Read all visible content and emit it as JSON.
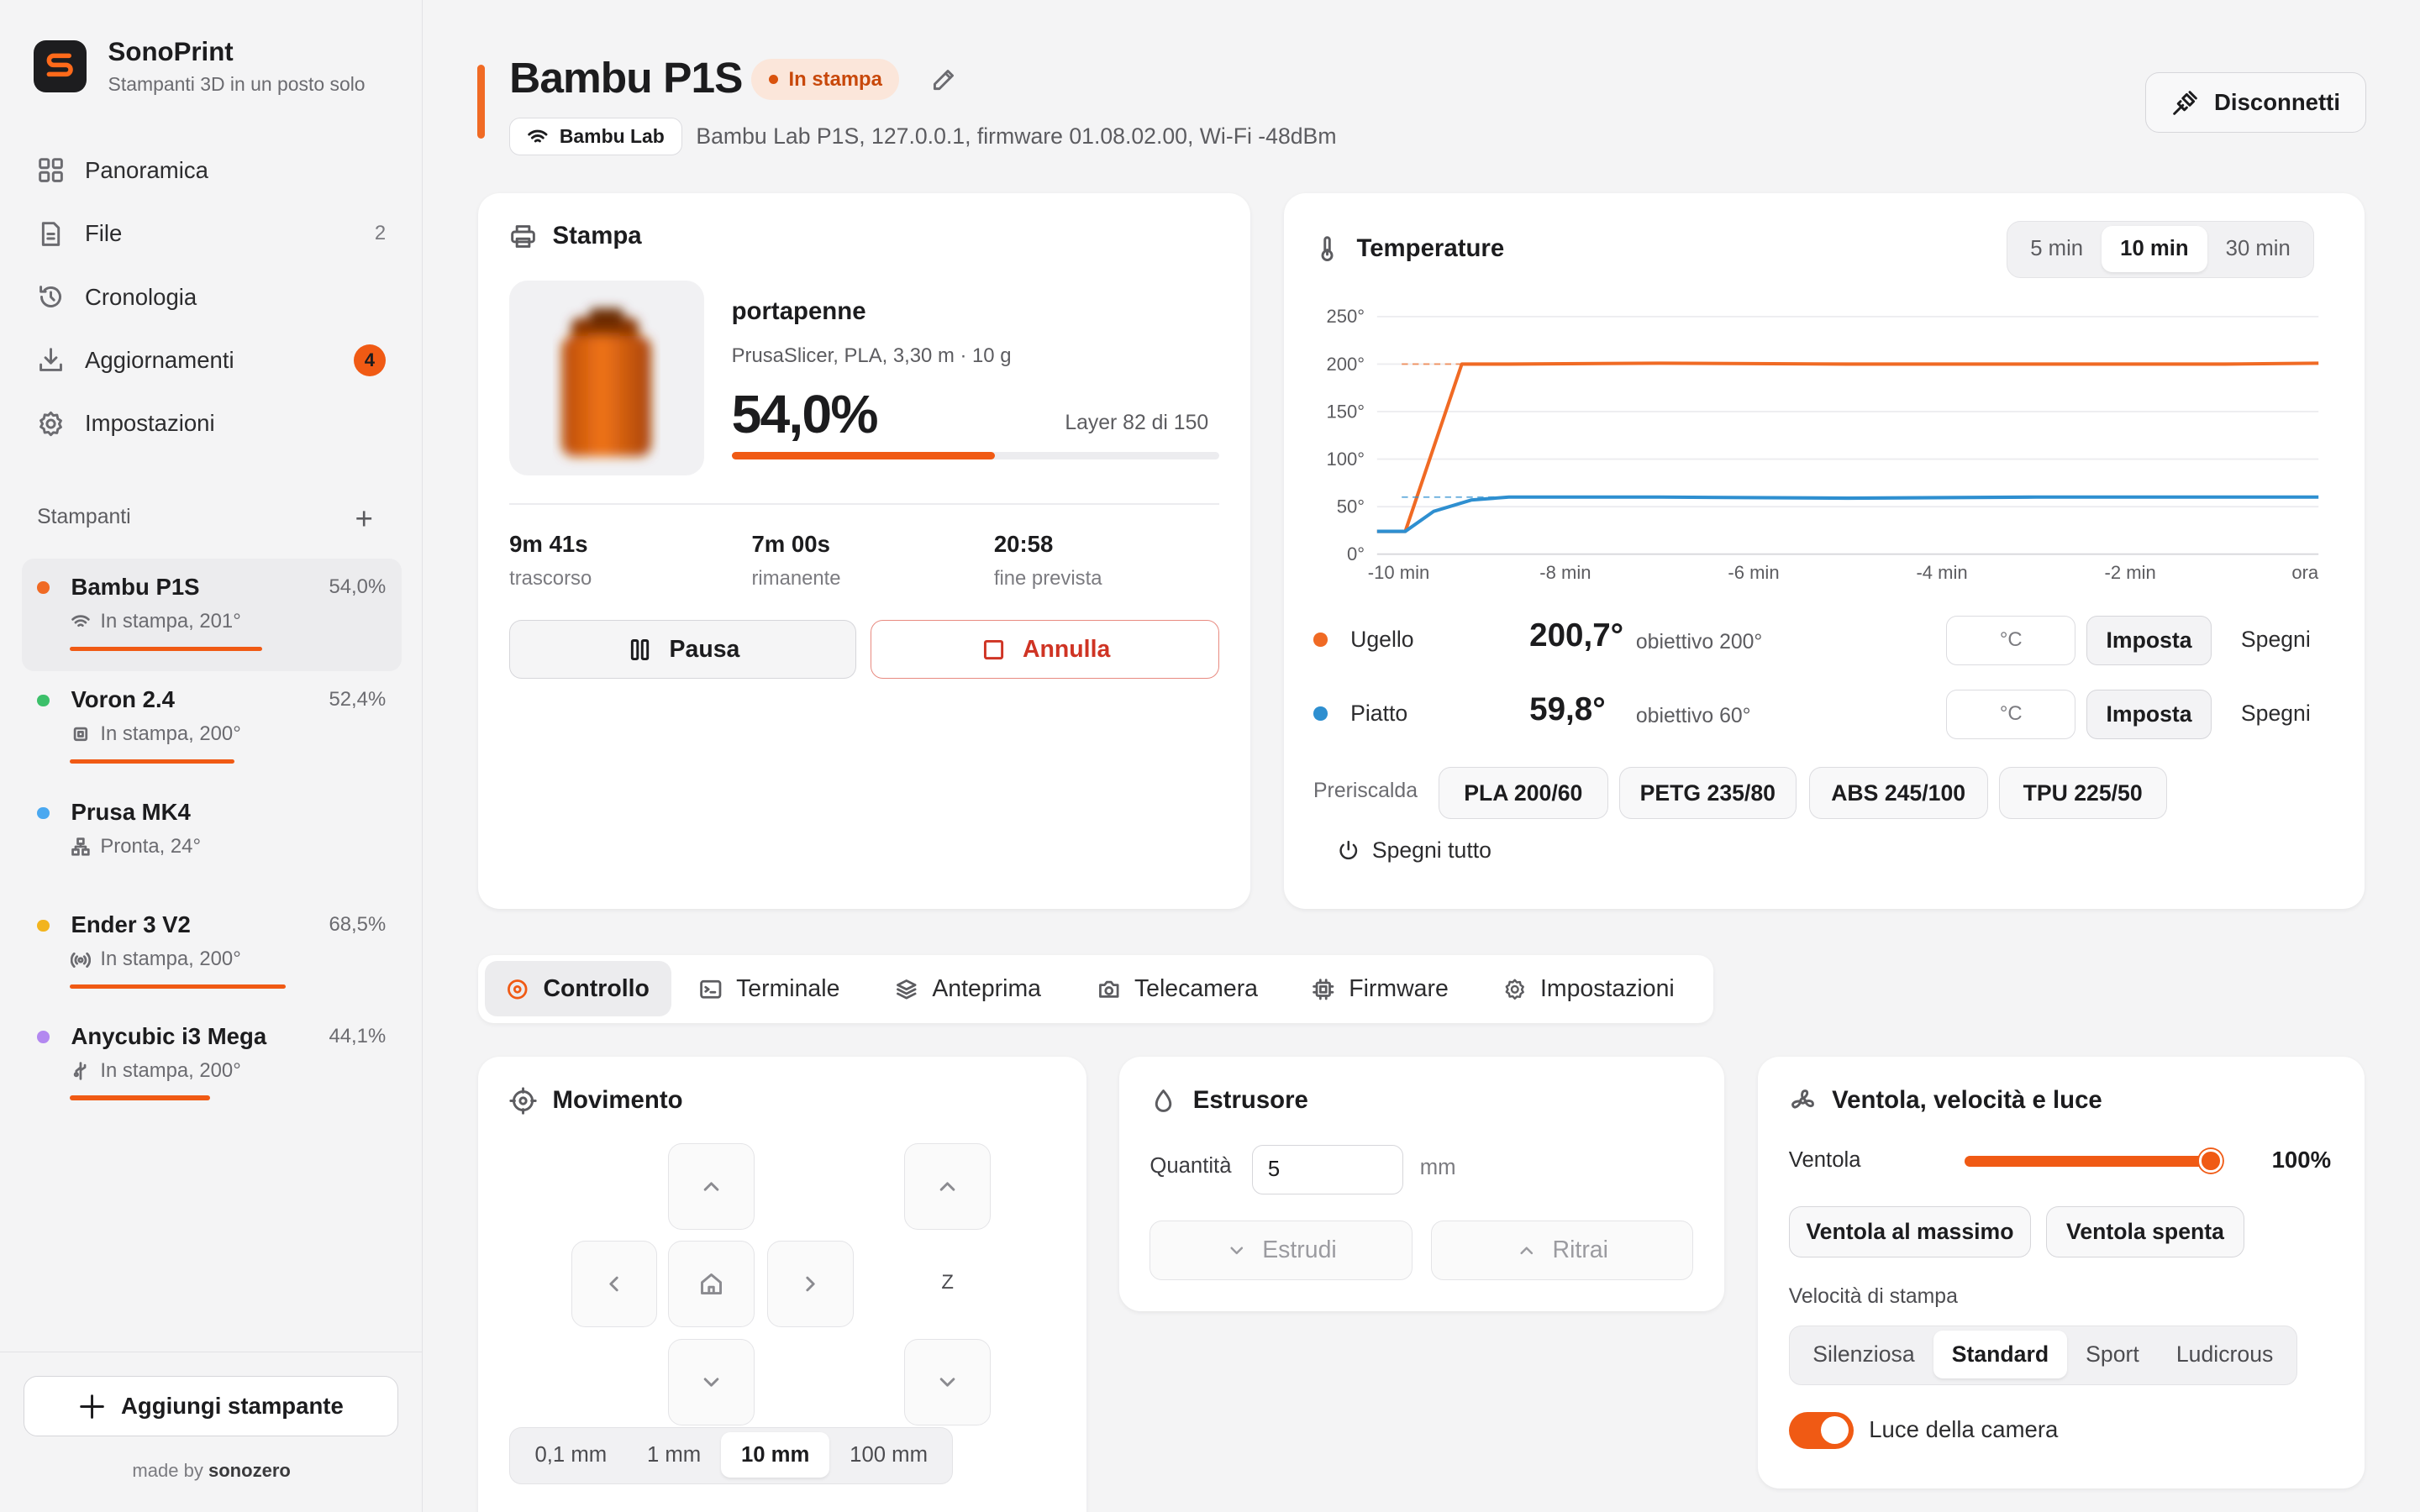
{
  "brand": {
    "name": "SonoPrint",
    "tagline": "Stampanti 3D in un posto solo",
    "logo": "S"
  },
  "nav": [
    {
      "label": "Panoramica",
      "icon": "grid-icon"
    },
    {
      "label": "File",
      "icon": "file-icon",
      "count": "2"
    },
    {
      "label": "Cronologia",
      "icon": "history-icon"
    },
    {
      "label": "Aggiornamenti",
      "icon": "download-icon",
      "badge": "4"
    },
    {
      "label": "Impostazioni",
      "icon": "gear-icon"
    }
  ],
  "printers_section": {
    "label": "Stampanti",
    "add": "+"
  },
  "printers": [
    {
      "name": "Bambu P1S",
      "percent": "54,0%",
      "status": "In stampa, 201°",
      "dot": "#f06a24",
      "progress": 0.54
    },
    {
      "name": "Voron 2.4",
      "percent": "52,4%",
      "status": "In stampa, 200°",
      "dot": "#3cc06a",
      "progress": 0.524
    },
    {
      "name": "Prusa MK4",
      "percent": "",
      "status": "Pronta, 24°",
      "dot": "#4aa8f0",
      "progress": 0
    },
    {
      "name": "Ender 3 V2",
      "percent": "68,5%",
      "status": "In stampa, 200°",
      "dot": "#f2b41e",
      "progress": 0.685
    },
    {
      "name": "Anycubic i3 Mega",
      "percent": "44,1%",
      "status": "In stampa, 200°",
      "dot": "#b388f0",
      "progress": 0.441
    }
  ],
  "sidebar_footer": {
    "add_printer": "Aggiungi stampante",
    "made_prefix": "made by",
    "made_by": "sonozero"
  },
  "header": {
    "title": "Bambu P1S",
    "status": "In stampa",
    "vendor": "Bambu Lab",
    "info": "Bambu Lab P1S, 127.0.0.1, firmware 01.08.02.00, Wi-Fi -48dBm",
    "disconnect": "Disconnetti"
  },
  "print_card": {
    "title": "Stampa",
    "file": "portapenne",
    "meta": "PrusaSlicer, PLA, 3,30 m · 10 g",
    "percent": "54,0%",
    "progress": 0.54,
    "layer": "Layer 82 di 150",
    "stats": [
      {
        "value": "9m 41s",
        "label": "trascorso"
      },
      {
        "value": "7m 00s",
        "label": "rimanente"
      },
      {
        "value": "20:58",
        "label": "fine prevista"
      }
    ],
    "pause": "Pausa",
    "cancel": "Annulla"
  },
  "temp_card": {
    "title": "Temperature",
    "ranges": [
      "5 min",
      "10 min",
      "30 min"
    ],
    "active_range": "10 min",
    "heaters": [
      {
        "name": "Ugello",
        "value": "200,7°",
        "target": "obiettivo 200°",
        "unit": "°C",
        "set": "Imposta",
        "off": "Spegni",
        "color": "#f06a24"
      },
      {
        "name": "Piatto",
        "value": "59,8°",
        "target": "obiettivo 60°",
        "unit": "°C",
        "set": "Imposta",
        "off": "Spegni",
        "color": "#2e8fd0"
      }
    ],
    "preheat_label": "Preriscalda",
    "presets": [
      "PLA 200/60",
      "PETG 235/80",
      "ABS 245/100",
      "TPU 225/50"
    ],
    "all_off": "Spegni tutto"
  },
  "chart_data": {
    "type": "line",
    "title": "",
    "xlabel": "",
    "ylabel": "",
    "x_ticks": [
      "-10 min",
      "-8 min",
      "-6 min",
      "-4 min",
      "-2 min",
      "ora"
    ],
    "y_ticks": [
      "0°",
      "50°",
      "100°",
      "150°",
      "200°",
      "250°"
    ],
    "xlim": [
      -10,
      0
    ],
    "ylim": [
      0,
      250
    ],
    "grid": true,
    "series": [
      {
        "x": [
          -10,
          -9.7,
          -9.1,
          -8.6,
          -7,
          -5,
          -3,
          -1,
          0
        ],
        "values": [
          24,
          24,
          200,
          200,
          201,
          200,
          200,
          200,
          201
        ],
        "target": 200,
        "color": "#f06a24"
      },
      {
        "x": [
          -10,
          -9.7,
          -9.4,
          -9,
          -8.6,
          -7,
          -5,
          -3,
          -1,
          0
        ],
        "values": [
          24,
          24,
          45,
          57,
          60,
          60,
          59,
          60,
          60,
          60
        ],
        "target": 60,
        "color": "#2e8fd0"
      }
    ]
  },
  "tabs": [
    {
      "label": "Controllo",
      "icon": "target-icon",
      "active": true
    },
    {
      "label": "Terminale",
      "icon": "terminal-icon"
    },
    {
      "label": "Anteprima",
      "icon": "layers-icon"
    },
    {
      "label": "Telecamera",
      "icon": "camera-icon"
    },
    {
      "label": "Firmware",
      "icon": "chip-icon"
    },
    {
      "label": "Impostazioni",
      "icon": "gear-icon"
    }
  ],
  "movement": {
    "title": "Movimento",
    "z_label": "Z",
    "steps": [
      "0,1 mm",
      "1 mm",
      "10 mm",
      "100 mm"
    ],
    "active_step": "10 mm"
  },
  "extruder": {
    "title": "Estrusore",
    "qty_label": "Quantità",
    "qty_value": "5",
    "unit": "mm",
    "extrude": "Estrudi",
    "retract": "Ritrai"
  },
  "fan": {
    "title": "Ventola, velocità e luce",
    "fan_label": "Ventola",
    "fan_value": "100%",
    "fan_level": 1.0,
    "max": "Ventola al massimo",
    "off": "Ventola spenta",
    "speed_label": "Velocità di stampa",
    "speeds": [
      "Silenziosa",
      "Standard",
      "Sport",
      "Ludicrous"
    ],
    "active_speed": "Standard",
    "light_label": "Luce della camera",
    "light_on": true
  }
}
